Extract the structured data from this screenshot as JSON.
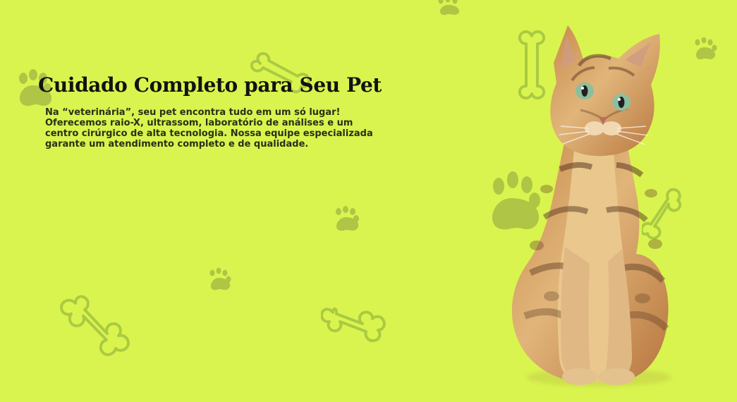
{
  "hero": {
    "title": "Cuidado Completo para Seu Pet",
    "description": "Na “veterinária”, seu pet encontra tudo em um só lugar! Oferecemos raio-X, ultrassom, laboratório de análises e um centro cirúrgico de alta tecnologia. Nossa equipe especializada garante um atendimento completo e de qualidade."
  },
  "colors": {
    "background": "#d9f44e",
    "title": "#121212",
    "text": "#283016",
    "decor_bone": "#a7c642",
    "decor_paw": "#aac145"
  },
  "decorations": {
    "bone_icon": "bone-icon",
    "paw_icon": "paw-print-icon"
  },
  "media": {
    "hero_image": "tabby-cat-photo"
  }
}
